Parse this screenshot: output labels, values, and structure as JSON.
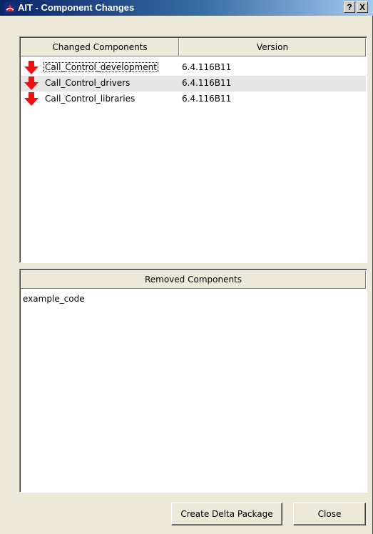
{
  "window": {
    "title": "AIT - Component Changes",
    "help_label": "?",
    "close_label": "X"
  },
  "changed": {
    "col_component": "Changed Components",
    "col_version": "Version",
    "rows": [
      {
        "name": "Call_Control_development",
        "version": "6.4.116B11",
        "icon": "down-arrow-icon"
      },
      {
        "name": "Call_Control_drivers",
        "version": "6.4.116B11",
        "icon": "down-arrow-icon"
      },
      {
        "name": "Call_Control_libraries",
        "version": "6.4.116B11",
        "icon": "down-arrow-icon"
      }
    ]
  },
  "removed": {
    "header": "Removed Components",
    "items": [
      "example_code"
    ]
  },
  "buttons": {
    "create_delta": "Create Delta Package",
    "close": "Close"
  },
  "colors": {
    "arrow": "#ee1111",
    "title_bar": "#0a246a"
  }
}
